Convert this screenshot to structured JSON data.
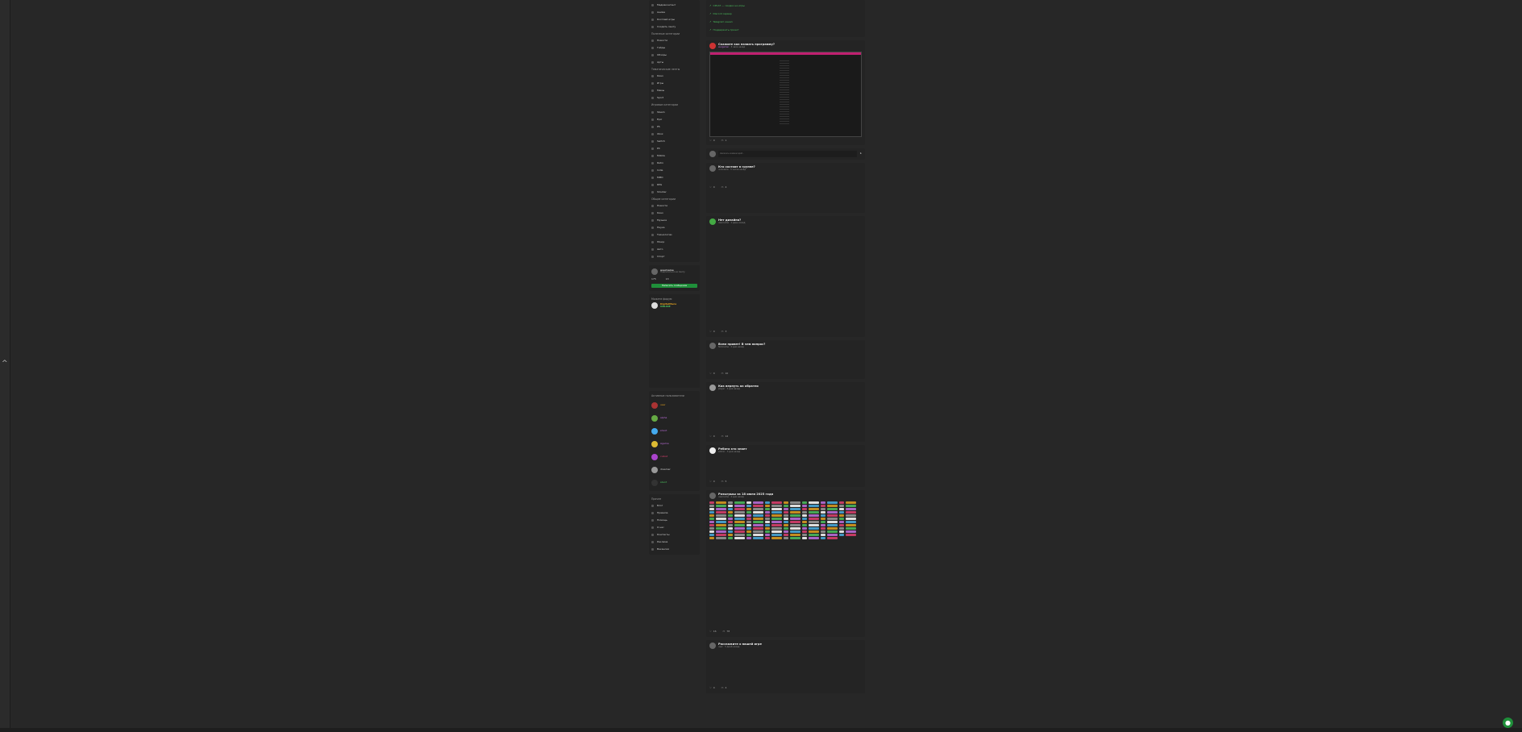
{
  "page": {
    "scroll_indicator": "^"
  },
  "sidebar": {
    "top_items": [
      "Медиаконтент",
      "Аниме",
      "Косплей игры",
      "Создать ленту"
    ],
    "sections": [
      {
        "title": "Полезные категории",
        "items": [
          "Новости",
          "Гайды",
          "Обзоры",
          "Арты"
        ]
      },
      {
        "title": "Тематические ленты",
        "items": [
          "Кино",
          "Игры",
          "Мемы",
          "Sport"
        ]
      },
      {
        "title": "Игровые категории",
        "items": [
          "Steam",
          "Epic",
          "PS",
          "Xbox",
          "Switch",
          "PC",
          "Mobile",
          "Retro",
          "Indie",
          "MMO",
          "RPG",
          "Shooter"
        ]
      },
      {
        "title": "Общие категории",
        "items": [
          "Новости",
          "Кино",
          "Музыка",
          "Наука",
          "Технологии",
          "Юмор",
          "Авто",
          "Спорт"
        ]
      }
    ],
    "profile": {
      "username": "username",
      "subtitle": "Подписаться на ленту",
      "stats": [
        "175",
        "13"
      ],
      "cta": "Написать сообщение"
    },
    "forum": {
      "title": "Можете форум",
      "user": "DigitalMans",
      "status": "ONLINE"
    },
    "active_users_title": "Активные пользователи",
    "active_users": [
      "user",
      "alpha",
      "shoot",
      "Agama",
      "cubist",
      "dreamer",
      "silent"
    ],
    "footer_title": "Прочее",
    "footer_items": [
      "Блог",
      "Правила",
      "Помощь",
      "О нас",
      "Контакты",
      "Реклама",
      "Вакансии"
    ]
  },
  "feed": {
    "links": [
      "CPCAT — скидки на игры",
      "Discord сервер",
      "Telegram канал",
      "Поддержать проект"
    ],
    "posts": [
      {
        "title": "Скажите как назвать программу?",
        "author": "wargamer",
        "meta": "3 часа назад",
        "likes": "0",
        "comments": "1"
      },
      {
        "title": "Кто состоит в группе?",
        "author": "nickname",
        "meta": "5 часов назад",
        "likes": "0",
        "comments": "4"
      },
      {
        "title": "Нет дизайна?",
        "author": "username",
        "meta": "1 день назад",
        "likes": "0",
        "comments": "3"
      },
      {
        "title": "Всем привет! В чем вопрос?",
        "author": "Nickname",
        "meta": "2 дня назад",
        "likes": "0",
        "comments": "10"
      },
      {
        "title": "Как вернуть ак обратно",
        "author": "player",
        "meta": "3 дня назад",
        "likes": "0",
        "comments": "12"
      },
      {
        "title": "Ребята кто знает",
        "author": "Admin",
        "meta": "3 дня назад",
        "likes": "0",
        "comments": "5"
      },
      {
        "title": "Розыгрыш за 18 июня 2025 года",
        "author": "username",
        "meta": "4 дня назад",
        "likes": "16",
        "comments": "78"
      },
      {
        "title": "Расскажите о вашей игре",
        "author": "user",
        "meta": "5 дней назад",
        "likes": "0",
        "comments": "4"
      }
    ],
    "comment_placeholder": "Написать комментарий..."
  }
}
